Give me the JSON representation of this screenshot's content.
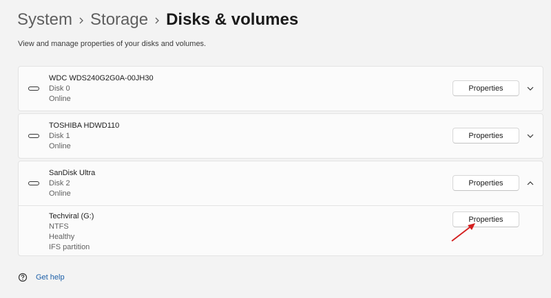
{
  "breadcrumb": {
    "items": [
      "System",
      "Storage",
      "Disks & volumes"
    ]
  },
  "description": "View and manage properties of your disks and volumes.",
  "disks": [
    {
      "name": "WDC WDS240G2G0A-00JH30",
      "number": "Disk 0",
      "status": "Online",
      "button": "Properties",
      "expanded": false
    },
    {
      "name": "TOSHIBA HDWD110",
      "number": "Disk 1",
      "status": "Online",
      "button": "Properties",
      "expanded": false
    },
    {
      "name": "SanDisk Ultra",
      "number": "Disk 2",
      "status": "Online",
      "button": "Properties",
      "expanded": true
    }
  ],
  "volume": {
    "name": "Techviral (G:)",
    "filesystem": "NTFS",
    "health": "Healthy",
    "type": "IFS partition",
    "button": "Properties"
  },
  "help": {
    "label": "Get help"
  },
  "colors": {
    "accent": "#1c5fa8",
    "annotation_arrow": "#d42020"
  },
  "icons": {
    "disk": "hard-drive-icon",
    "chevron_down": "chevron-down-icon",
    "chevron_up": "chevron-up-icon",
    "help": "help-icon",
    "separator": "chevron-right-icon"
  }
}
